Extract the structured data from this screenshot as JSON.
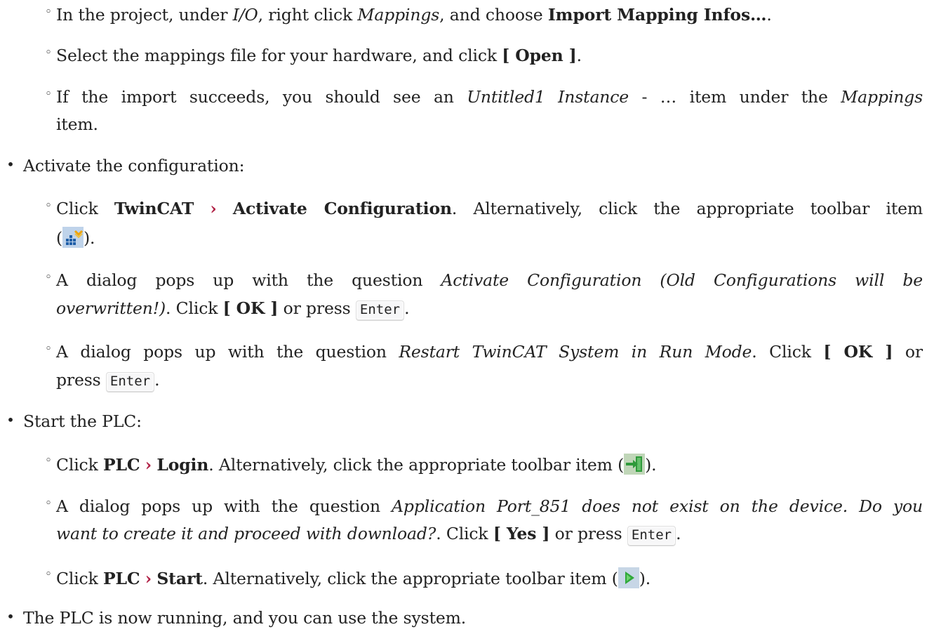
{
  "section_import": {
    "item1": {
      "pre": "In the project, under ",
      "em1": "I/O",
      "mid": ", right click ",
      "em2": "Mappings",
      "mid2": ", and choose ",
      "strong1": "Import Mapping Infos…",
      "post": "."
    },
    "item2": {
      "pre": "Select the mappings file for your hardware, and click ",
      "strong1": "[ Open ]",
      "post": "."
    },
    "item3": {
      "pre": "If the import succeeds, you should see an ",
      "em1": "Untitled1 Instance",
      "mid": " - … item under the ",
      "em2": "Mappings",
      "line2": "item."
    }
  },
  "section_activate": {
    "title": "Activate the configuration:",
    "item1": {
      "pre": "Click ",
      "strong1": "TwinCAT",
      "chev": "›",
      "strong2": "Activate Configuration",
      "post": ". Alternatively, click the appropriate toolbar item",
      "line2_pre": "(",
      "icon": "activate-configuration-icon",
      "line2_post": ")."
    },
    "item2": {
      "pre": "A dialog pops up with the question ",
      "em1": "Activate Configuration (Old Configurations will be",
      "em1b": "overwritten!)",
      "mid": ". Click ",
      "strong1": "[ OK ]",
      "mid2": " or press ",
      "kbd": "Enter",
      "post": "."
    },
    "item3": {
      "pre": "A dialog pops up with the question ",
      "em1": "Restart TwinCAT System in Run Mode",
      "mid": ". Click ",
      "strong1": "[ OK ]",
      "mid2": " or",
      "line2_pre": "press ",
      "kbd": "Enter",
      "post": "."
    }
  },
  "section_start": {
    "title": "Start the PLC:",
    "item1": {
      "pre": "Click ",
      "strong1": "PLC",
      "chev": "›",
      "strong2": "Login",
      "post": ". Alternatively, click the appropriate toolbar item (",
      "icon": "login-icon",
      "end": ")."
    },
    "item2": {
      "pre": "A dialog pops up with the question ",
      "em1": "Application Port_851 does not exist on the device. Do you",
      "em1b": "want to create it and proceed with download?",
      "mid": ". Click ",
      "strong1": "[ Yes ]",
      "mid2": " or press ",
      "kbd": "Enter",
      "post": "."
    },
    "item3": {
      "pre": "Click ",
      "strong1": "PLC",
      "chev": "›",
      "strong2": "Start",
      "post": ". Alternatively, click the appropriate toolbar item (",
      "icon": "start-icon",
      "end": ")."
    }
  },
  "final_line": "The PLC is now running, and you can use the system.",
  "glyphs": {
    "bullet": "•",
    "sub_bullet": "◦"
  },
  "colors": {
    "text": "#222222",
    "menu_chevron": "#b12146",
    "kbd_border": "#dddddd"
  }
}
